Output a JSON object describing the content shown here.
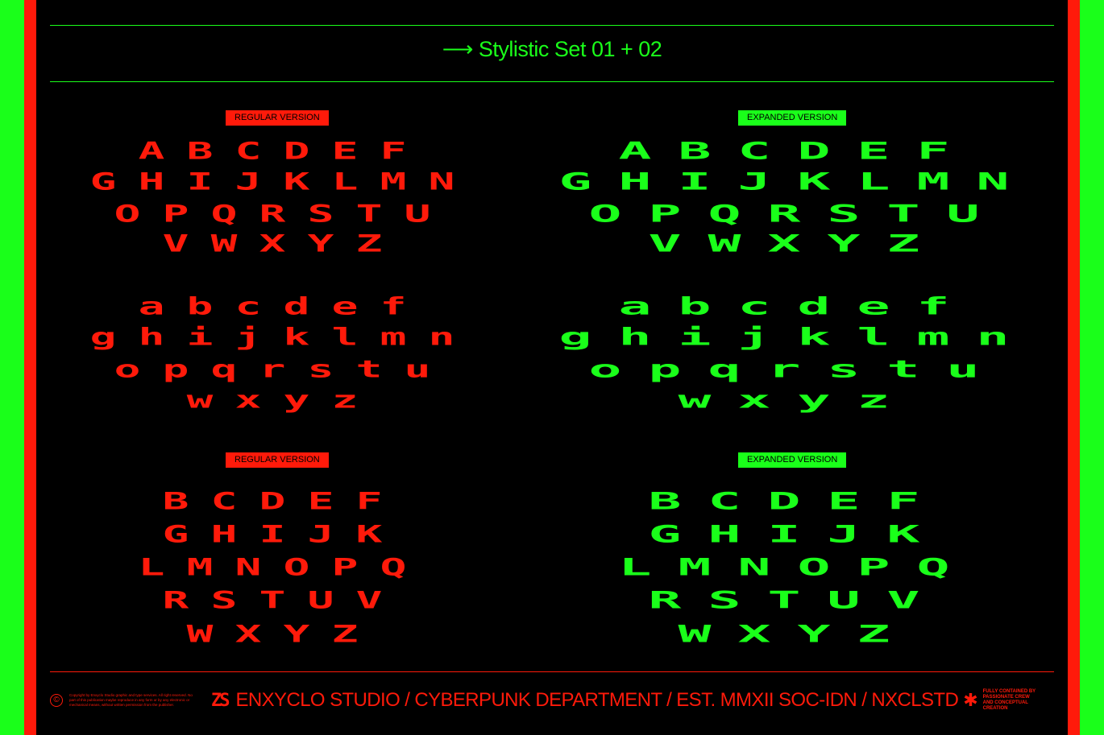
{
  "colors": {
    "red": "#ff1a0a",
    "green": "#1aff1a",
    "background": "#000000"
  },
  "title": "⟶ Stylistic Set 01 + 02",
  "sections": [
    {
      "regular_badge": "REGULAR VERSION",
      "expanded_badge": "EXPANDED VERSION",
      "rows": [
        [
          "A",
          "B",
          "C",
          "D",
          "E",
          "F"
        ],
        [
          "G",
          "H",
          "I",
          "J",
          "K",
          "L",
          "M",
          "N"
        ],
        [
          "O",
          "P",
          "Q",
          "R",
          "S",
          "T",
          "U"
        ],
        [
          "V",
          "W",
          "X",
          "Y",
          "Z"
        ]
      ]
    },
    {
      "rows": [
        [
          "a",
          "b",
          "c",
          "d",
          "e",
          "f"
        ],
        [
          "g",
          "h",
          "i",
          "j",
          "k",
          "l",
          "m",
          "n"
        ],
        [
          "o",
          "p",
          "q",
          "r",
          "s",
          "t",
          "u"
        ],
        [
          "w",
          "x",
          "y",
          "z"
        ]
      ]
    },
    {
      "regular_badge": "REGULAR VERSION",
      "expanded_badge": "EXPANDED VERSION",
      "rows": [
        [
          "B",
          "C",
          "D",
          "E",
          "F"
        ],
        [
          "G",
          "H",
          "I",
          "J",
          "K"
        ],
        [
          "L",
          "M",
          "N",
          "O",
          "P",
          "Q"
        ],
        [
          "R",
          "S",
          "T",
          "U",
          "V"
        ],
        [
          "W",
          "X",
          "Y",
          "Z"
        ]
      ]
    }
  ],
  "footer": {
    "copyright_icon": "copyright-icon",
    "copyright": "Copyright by Enxyclo Studio graphic and type services. All right reserved. No part of this publication maybe reproduce in any form or by any electronic or mechanical means, without written permission from the publisher.",
    "logo": "ZS",
    "main": "ENXYCLO STUDIO / CYBERPUNK DEPARTMENT / EST. MMXII SOC-IDN / NXCLSTD",
    "asterisk_icon": "asterisk-icon",
    "tagline": "FULLY CONTAINED BY PASSIONATE CREW AND CONCEPTUAL CREATION"
  }
}
